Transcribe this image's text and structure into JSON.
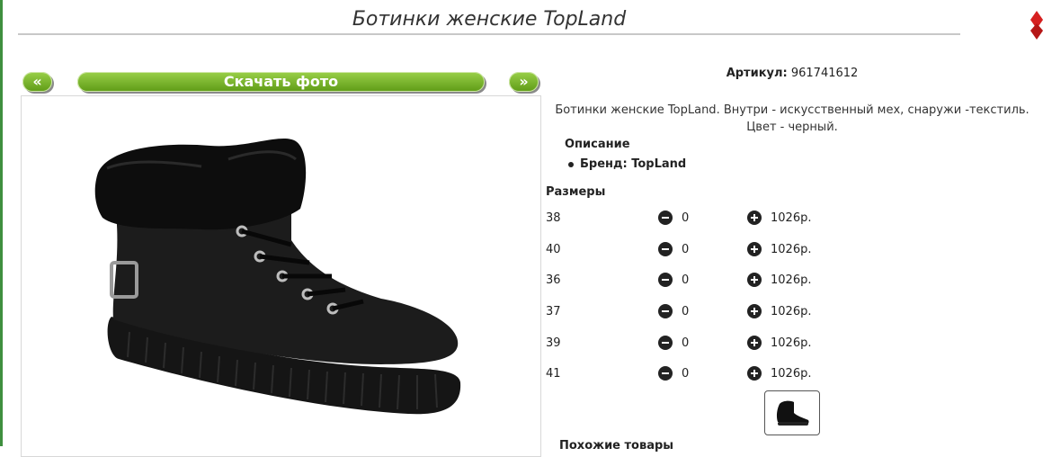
{
  "page": {
    "title": "Ботинки женские TopLand"
  },
  "gallery": {
    "prev_label": "«",
    "download_label": "Скачать фото",
    "next_label": "»"
  },
  "product": {
    "article_label": "Артикул:",
    "article_value": "961741612",
    "description": "Ботинки женские TopLand. Внутри - искусственный мех, снаружи -текстиль. Цвет - черный.",
    "description_heading": "Описание",
    "brand": "Бренд: TopLand"
  },
  "sizes": {
    "heading": "Размеры",
    "rows": [
      {
        "size": "38",
        "qty": "0",
        "price": "1026р."
      },
      {
        "size": "40",
        "qty": "0",
        "price": "1026р."
      },
      {
        "size": "36",
        "qty": "0",
        "price": "1026р."
      },
      {
        "size": "37",
        "qty": "0",
        "price": "1026р."
      },
      {
        "size": "39",
        "qty": "0",
        "price": "1026р."
      },
      {
        "size": "41",
        "qty": "0",
        "price": "1026р."
      }
    ]
  },
  "bottom": {
    "heading": "Похожие товары"
  },
  "colors": {
    "accent_green": "#6fae22",
    "border_green": "#3f8f3f",
    "corner_red": "#d62020"
  }
}
